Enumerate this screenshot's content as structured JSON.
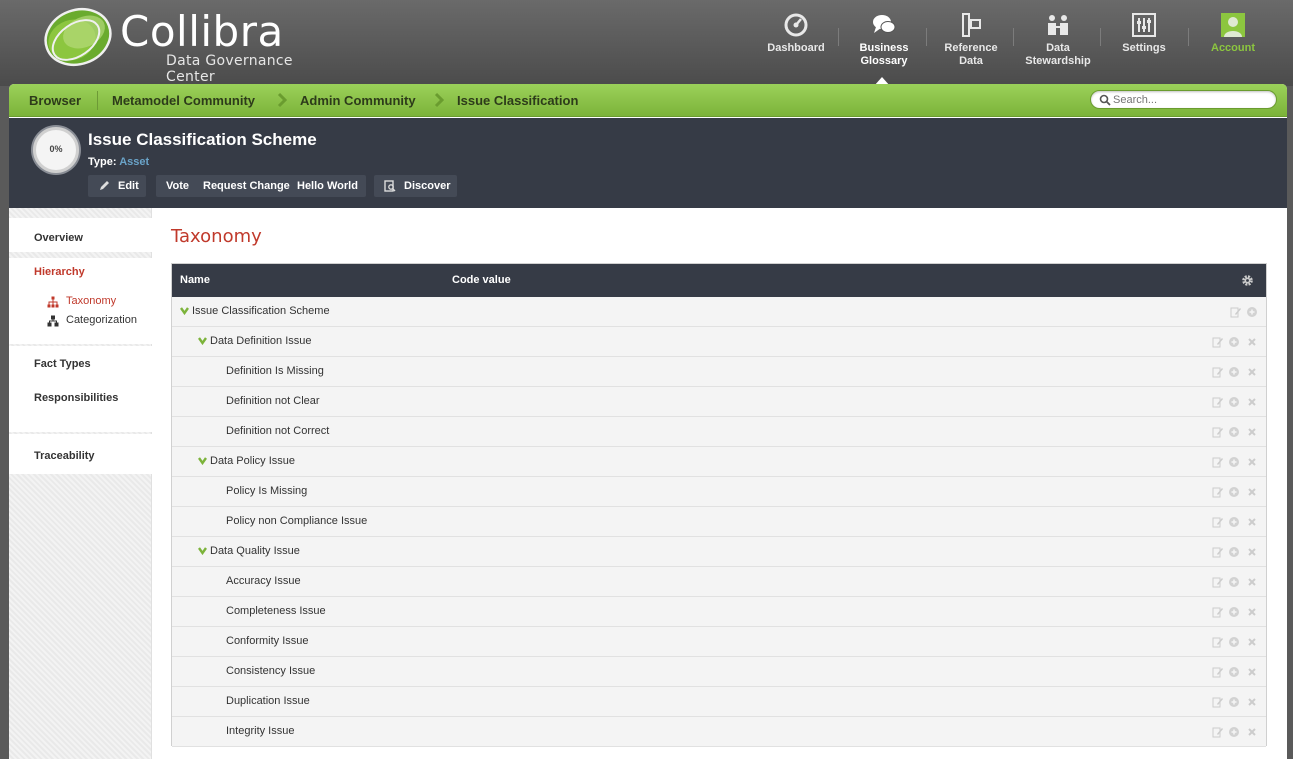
{
  "app": {
    "logo_name": "Collibra",
    "logo_subtitle": "Data Governance Center"
  },
  "nav": {
    "items": [
      {
        "label": "Dashboard",
        "icon": "dashboard-icon"
      },
      {
        "label": "Business\nGlossary",
        "icon": "speech-bubbles-icon"
      },
      {
        "label": "Reference\nData",
        "icon": "reference-data-icon"
      },
      {
        "label": "Data\nStewardship",
        "icon": "stewardship-icon"
      },
      {
        "label": "Settings",
        "icon": "sliders-icon"
      },
      {
        "label": "Account",
        "icon": "user-avatar-icon"
      }
    ]
  },
  "breadcrumb": {
    "browser": "Browser",
    "items": [
      "Metamodel Community",
      "Admin Community",
      "Issue Classification"
    ]
  },
  "search": {
    "placeholder": "Search..."
  },
  "asset": {
    "progress": "0%",
    "title": "Issue Classification Scheme",
    "type_label": "Type:",
    "type_value": "Asset",
    "actions": {
      "edit": "Edit",
      "vote": "Vote",
      "request_change": "Request Change",
      "hello_world": "Hello World",
      "discover": "Discover"
    }
  },
  "sidebar": {
    "overview": "Overview",
    "hierarchy": "Hierarchy",
    "taxonomy": "Taxonomy",
    "categorization": "Categorization",
    "fact_types": "Fact Types",
    "responsibilities": "Responsibilities",
    "traceability": "Traceability"
  },
  "content": {
    "title": "Taxonomy",
    "columns": {
      "name": "Name",
      "code": "Code value"
    },
    "rows": [
      {
        "name": "Issue Classification Scheme",
        "level": 0,
        "expanded": true
      },
      {
        "name": "Data Definition Issue",
        "level": 1,
        "expanded": true
      },
      {
        "name": "Definition Is Missing",
        "level": 2
      },
      {
        "name": "Definition not Clear",
        "level": 2
      },
      {
        "name": "Definition not Correct",
        "level": 2
      },
      {
        "name": "Data Policy Issue",
        "level": 1,
        "expanded": true
      },
      {
        "name": "Policy Is Missing",
        "level": 2
      },
      {
        "name": "Policy non Compliance Issue",
        "level": 2
      },
      {
        "name": "Data Quality Issue",
        "level": 1,
        "expanded": true
      },
      {
        "name": "Accuracy Issue",
        "level": 2
      },
      {
        "name": "Completeness Issue",
        "level": 2
      },
      {
        "name": "Conformity Issue",
        "level": 2
      },
      {
        "name": "Consistency Issue",
        "level": 2
      },
      {
        "name": "Duplication Issue",
        "level": 2
      },
      {
        "name": "Integrity Issue",
        "level": 2
      }
    ]
  },
  "colors": {
    "accent_green": "#8cc63f",
    "dark_header": "#363b46",
    "active_red": "#c0392b",
    "link_blue": "#6aa3c8"
  }
}
